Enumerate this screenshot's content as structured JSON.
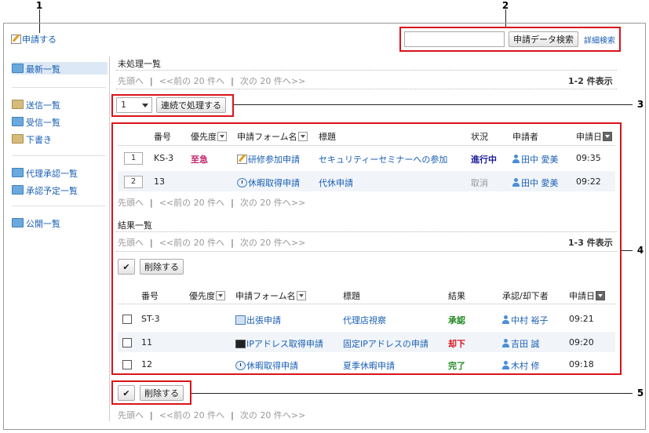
{
  "callouts": [
    "1",
    "2",
    "3",
    "4",
    "5"
  ],
  "top": {
    "apply_label": "申請する"
  },
  "search": {
    "value": "",
    "button_label": "申請データ検索",
    "advanced_label": "詳細検索"
  },
  "sidebar": {
    "items": [
      {
        "label": "最新一覧",
        "folder": "blue"
      },
      {
        "label": "送信一覧",
        "folder": "tan"
      },
      {
        "label": "受信一覧",
        "folder": "blue"
      },
      {
        "label": "下書き",
        "folder": "tan"
      },
      {
        "label": "代理承認一覧",
        "folder": "blue"
      },
      {
        "label": "承認予定一覧",
        "folder": "blue"
      },
      {
        "label": "公開一覧",
        "folder": "blue"
      }
    ]
  },
  "pager": {
    "first": "先頭へ",
    "prev": "<<前の 20 件へ",
    "next": "次の 20 件へ>>",
    "sep": "|"
  },
  "pending": {
    "title": "未処理一覧",
    "count": "1-2 件表示",
    "batch_select_value": "1",
    "batch_button": "連続で処理する",
    "headers": [
      "番号",
      "優先度",
      "申請フォーム名",
      "標題",
      "状況",
      "申請者",
      "申請日"
    ],
    "rows": [
      {
        "index": "1",
        "number": "KS-3",
        "priority": "至急",
        "form": "研修参加申請",
        "form_icon": "edit-icon",
        "subject": "セキュリティーセミナーへの参加",
        "status": "進行中",
        "applicant": "田中 愛美",
        "date": "09:35"
      },
      {
        "index": "2",
        "number": "13",
        "priority": "",
        "form": "休暇取得申請",
        "form_icon": "clock-icon",
        "subject": "代休申請",
        "status": "取消",
        "applicant": "田中 愛美",
        "date": "09:22"
      }
    ]
  },
  "results": {
    "title": "結果一覧",
    "count": "1-3 件表示",
    "check_all": "✔",
    "delete_button": "削除する",
    "headers": [
      "番号",
      "優先度",
      "申請フォーム名",
      "標題",
      "結果",
      "承認/却下者",
      "申請日"
    ],
    "rows": [
      {
        "number": "ST-3",
        "form": "出張申請",
        "form_icon": "trip-icon",
        "subject": "代理店視察",
        "result": "承認",
        "approver": "中村 裕子",
        "date": "09:21"
      },
      {
        "number": "11",
        "form": "IPアドレス取得申請",
        "form_icon": "pc-icon",
        "subject": "固定IPアドレスの申請",
        "result": "却下",
        "approver": "吉田 誠",
        "date": "09:20"
      },
      {
        "number": "12",
        "form": "休暇取得申請",
        "form_icon": "clock-icon",
        "subject": "夏季休暇申請",
        "result": "完了",
        "approver": "木村 修",
        "date": "09:18"
      }
    ]
  },
  "colors": {
    "accent": "#d9141a",
    "link": "#1a5fb4",
    "urgent": "#c0246c",
    "approve": "#228b22",
    "reject": "#d9141a",
    "inprogress": "#1a1a9c"
  }
}
